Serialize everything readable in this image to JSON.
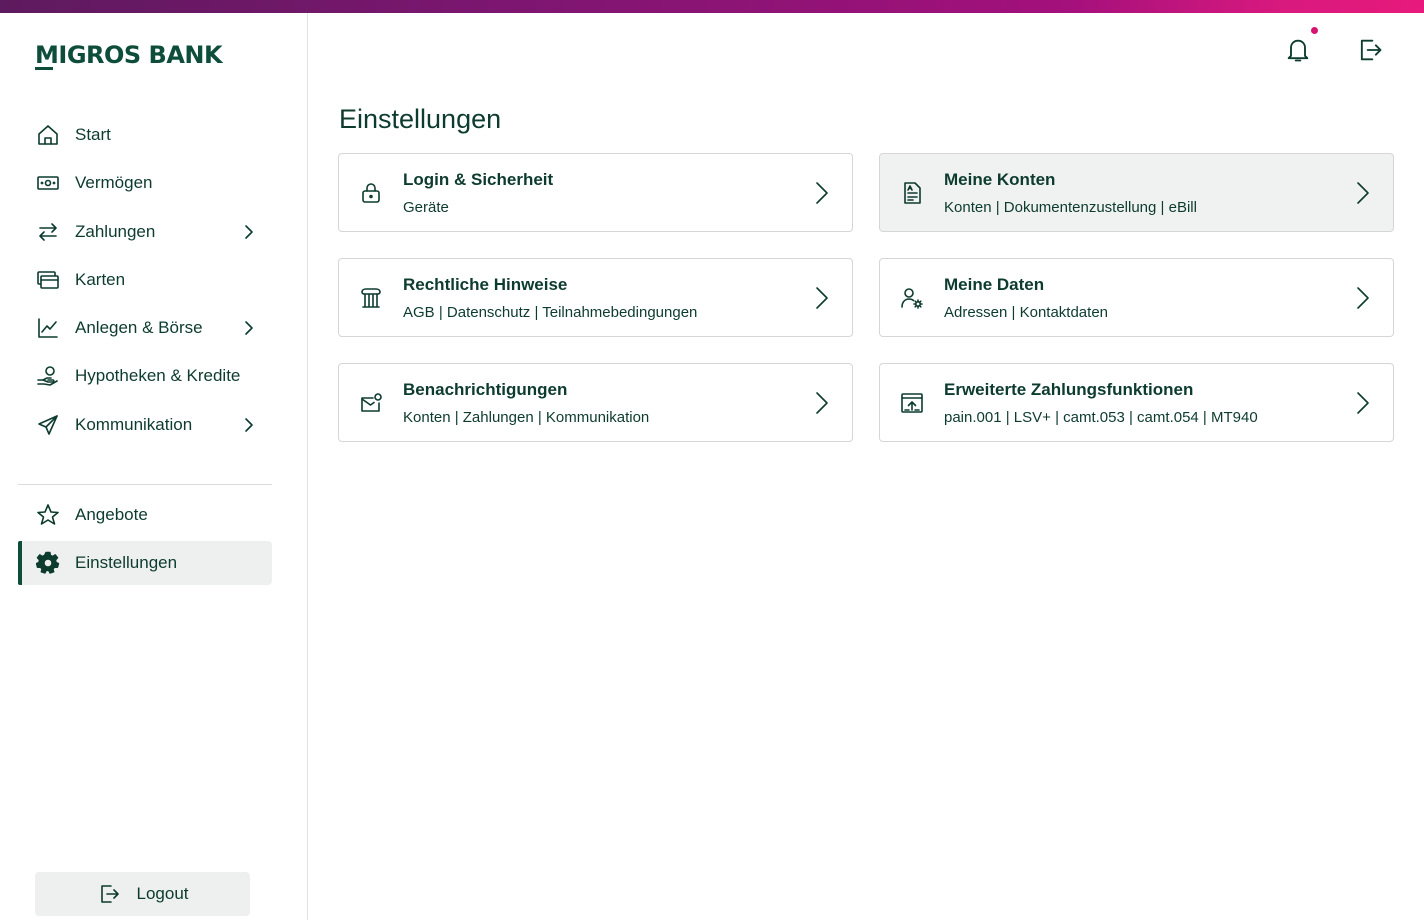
{
  "brand": {
    "name": "MIGROS BANK"
  },
  "sidebar": {
    "items": [
      {
        "label": "Start",
        "icon": "home-icon",
        "has_submenu": false
      },
      {
        "label": "Vermögen",
        "icon": "banknote-icon",
        "has_submenu": false
      },
      {
        "label": "Zahlungen",
        "icon": "arrows-exchange-icon",
        "has_submenu": true
      },
      {
        "label": "Karten",
        "icon": "cards-icon",
        "has_submenu": false
      },
      {
        "label": "Anlegen & Börse",
        "icon": "chart-line-icon",
        "has_submenu": true
      },
      {
        "label": "Hypotheken & Kredite",
        "icon": "hand-coin-icon",
        "has_submenu": false
      },
      {
        "label": "Kommunikation",
        "icon": "paper-plane-icon",
        "has_submenu": true
      }
    ],
    "secondary_items": [
      {
        "label": "Angebote",
        "icon": "star-icon",
        "active": false
      },
      {
        "label": "Einstellungen",
        "icon": "gear-icon",
        "active": true
      }
    ],
    "logout_label": "Logout"
  },
  "header": {
    "notification_icon": "bell-icon",
    "logout_icon": "logout-icon",
    "has_unread": true
  },
  "main": {
    "title": "Einstellungen",
    "cards": [
      {
        "title": "Login & Sicherheit",
        "subtitle": "Geräte",
        "icon": "lock-icon"
      },
      {
        "title": "Meine Konten",
        "subtitle": "Konten | Dokumentenzustellung | eBill",
        "icon": "document-icon"
      },
      {
        "title": "Rechtliche Hinweise",
        "subtitle": "AGB | Datenschutz | Teilnahmebedingungen",
        "icon": "bank-building-icon"
      },
      {
        "title": "Meine Daten",
        "subtitle": "Adressen | Kontaktdaten",
        "icon": "user-settings-icon"
      },
      {
        "title": "Benachrichtigungen",
        "subtitle": "Konten | Zahlungen | Kommunikation",
        "icon": "mail-notification-icon"
      },
      {
        "title": "Erweiterte Zahlungsfunktionen",
        "subtitle": "pain.001 | LSV+ | camt.053 | camt.054 | MT940",
        "icon": "upload-window-icon"
      }
    ]
  },
  "colors": {
    "primary": "#0d3b2e",
    "accent": "#d4146e",
    "active_bg": "#eef0ef"
  }
}
